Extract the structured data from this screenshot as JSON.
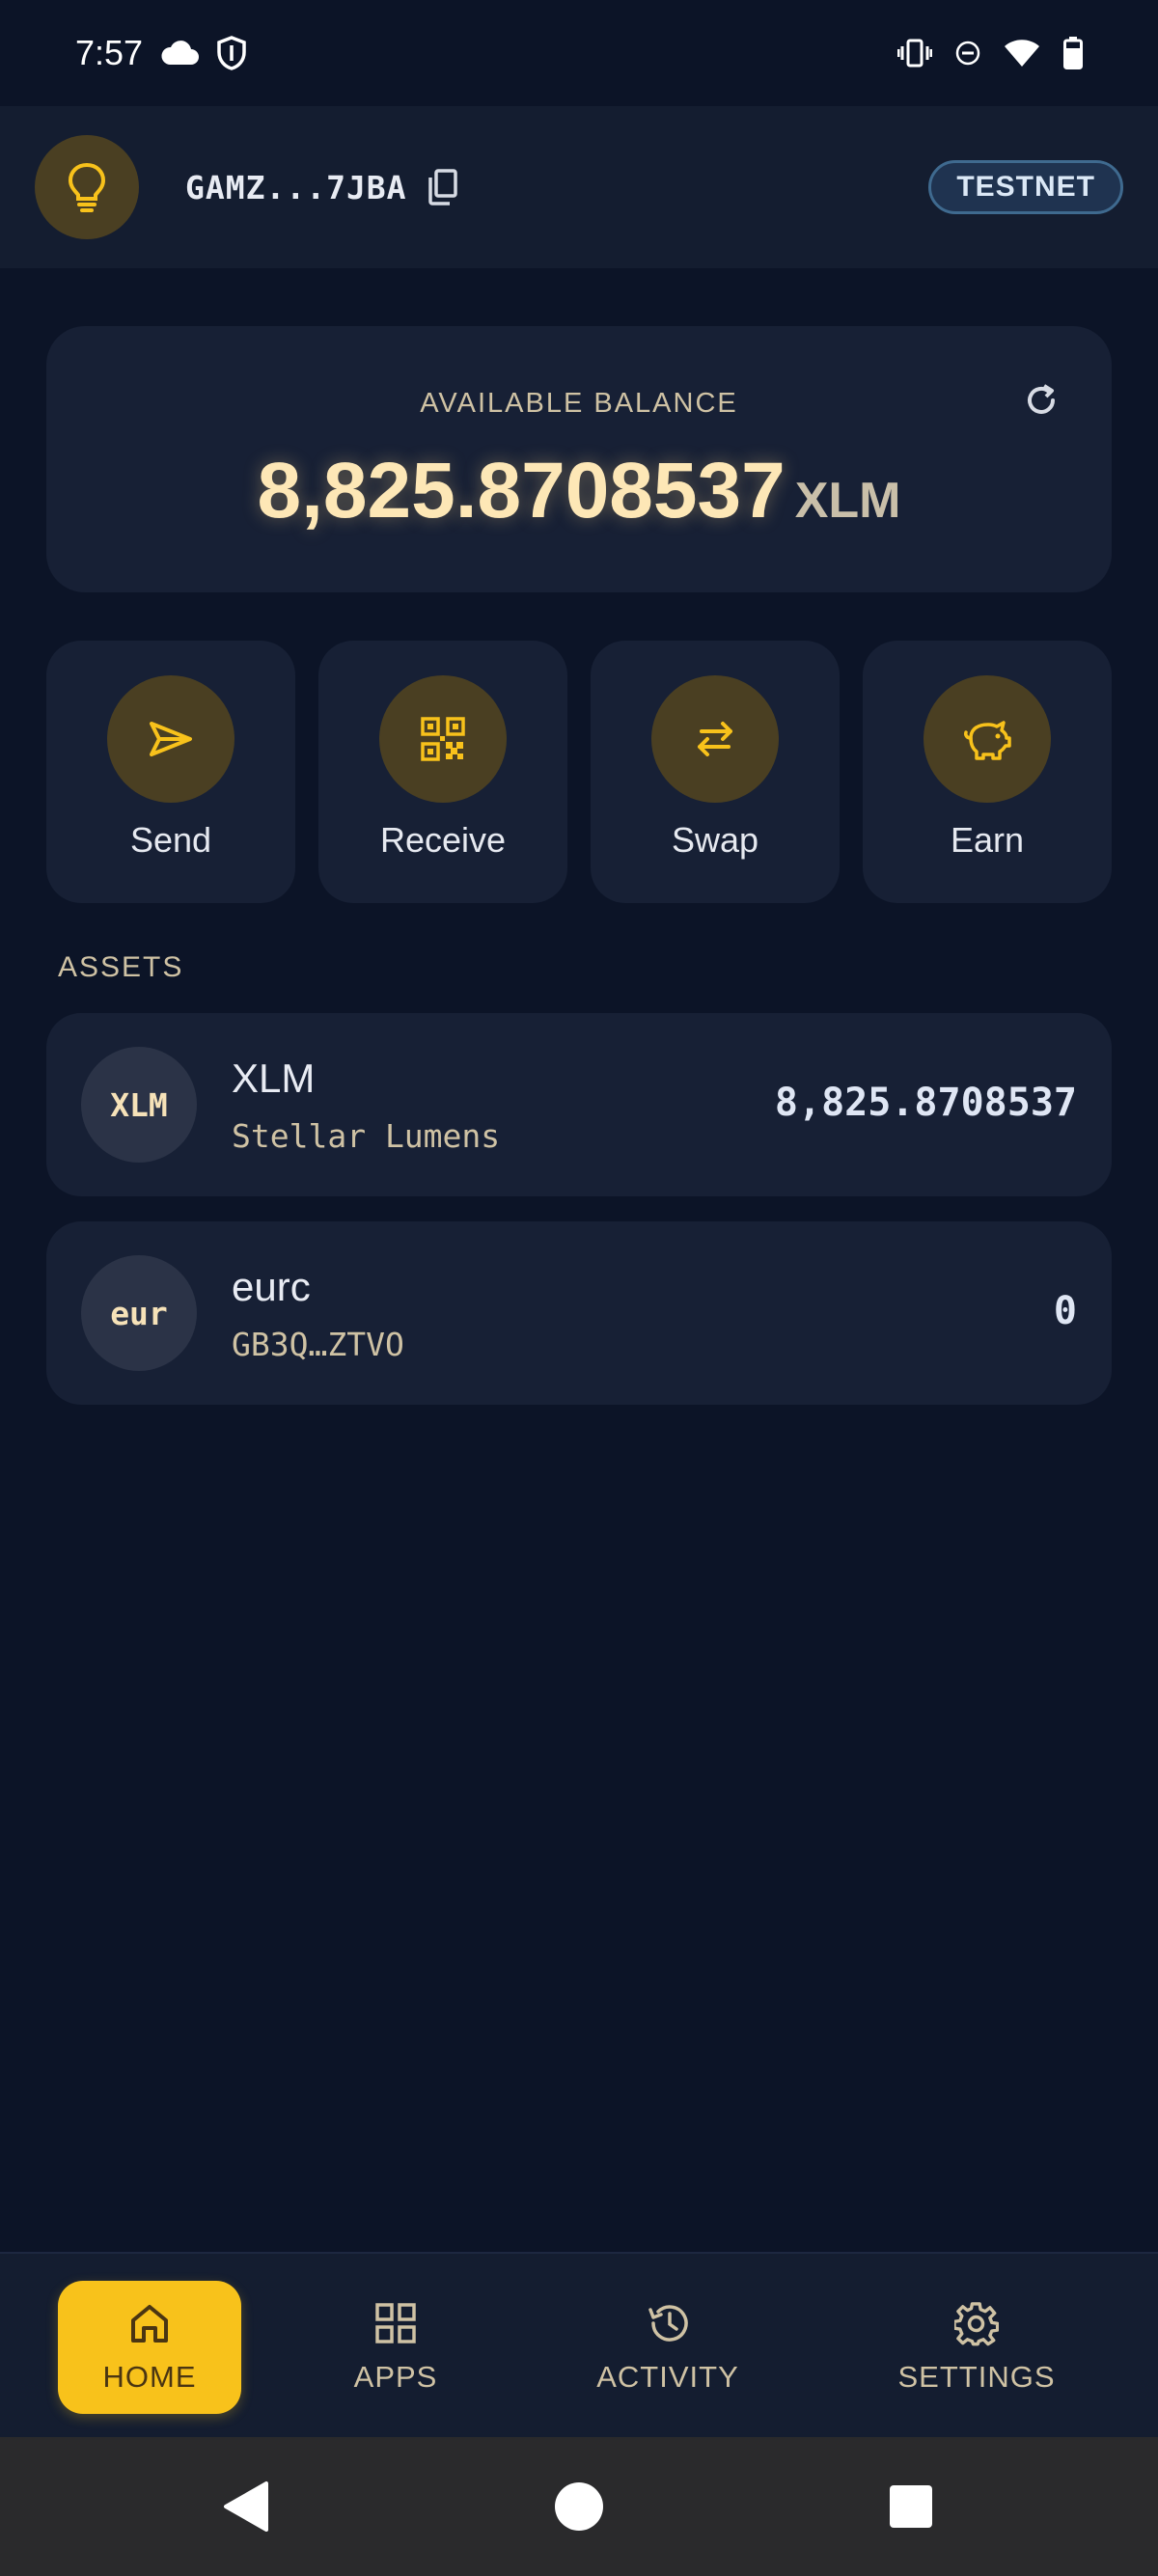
{
  "status_bar": {
    "time": "7:57",
    "icons_left": [
      "cloud-icon",
      "shield-icon"
    ],
    "icons_right": [
      "vibrate-icon",
      "do-not-disturb-icon",
      "wifi-icon",
      "battery-icon"
    ]
  },
  "header": {
    "avatar_icon": "lightbulb-icon",
    "address": "GAMZ...7JBA",
    "copy_icon": "copy-icon",
    "network_badge": "TESTNET"
  },
  "balance": {
    "label": "AVAILABLE BALANCE",
    "amount": "8,825.8708537",
    "unit": "XLM",
    "refresh_icon": "refresh-icon"
  },
  "actions": [
    {
      "label": "Send",
      "icon": "send-icon"
    },
    {
      "label": "Receive",
      "icon": "qr-code-icon"
    },
    {
      "label": "Swap",
      "icon": "swap-icon"
    },
    {
      "label": "Earn",
      "icon": "piggy-bank-icon"
    }
  ],
  "assets": {
    "title": "ASSETS",
    "items": [
      {
        "icon_text": "XLM",
        "name": "XLM",
        "subtitle": "Stellar Lumens",
        "amount": "8,825.8708537"
      },
      {
        "icon_text": "eur",
        "name": "eurc",
        "subtitle": "GB3Q…ZTVO",
        "amount": "0"
      }
    ]
  },
  "bottom_nav": [
    {
      "label": "HOME",
      "icon": "home-icon",
      "active": true
    },
    {
      "label": "APPS",
      "icon": "grid-icon",
      "active": false
    },
    {
      "label": "ACTIVITY",
      "icon": "history-icon",
      "active": false
    },
    {
      "label": "SETTINGS",
      "icon": "gear-icon",
      "active": false
    }
  ],
  "colors": {
    "background": "#0c1427",
    "card": "#172035",
    "accent": "#f8c21b",
    "accent_circle": "#4a3f22",
    "balance_text": "#fde7b6"
  }
}
